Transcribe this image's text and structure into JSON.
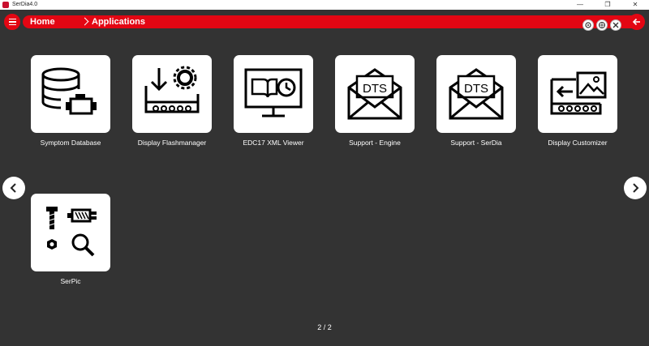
{
  "window": {
    "title": "SerDia4.0",
    "minimize": "—",
    "maximize": "❐",
    "close": "✕"
  },
  "colors": {
    "accent": "#e30613",
    "background": "#333333",
    "tile": "#ffffff"
  },
  "breadcrumb": {
    "home": "Home",
    "current": "Applications"
  },
  "toolbar": {
    "icons": [
      "settings-icon",
      "network-icon",
      "tools-icon"
    ]
  },
  "apps": [
    {
      "label": "Symptom Database",
      "icon": "database-engine-icon"
    },
    {
      "label": "Display Flashmanager",
      "icon": "download-gear-icon"
    },
    {
      "label": "EDC17 XML Viewer",
      "icon": "monitor-book-clock-icon"
    },
    {
      "label": "Support - Engine",
      "icon": "envelope-dts-icon",
      "badge": "DTS"
    },
    {
      "label": "Support - SerDia",
      "icon": "envelope-dts-icon",
      "badge": "DTS"
    },
    {
      "label": "Display Customizer",
      "icon": "display-image-icon"
    },
    {
      "label": "SerPic",
      "icon": "parts-search-icon"
    }
  ],
  "pagination": {
    "current": "2 / 2"
  }
}
